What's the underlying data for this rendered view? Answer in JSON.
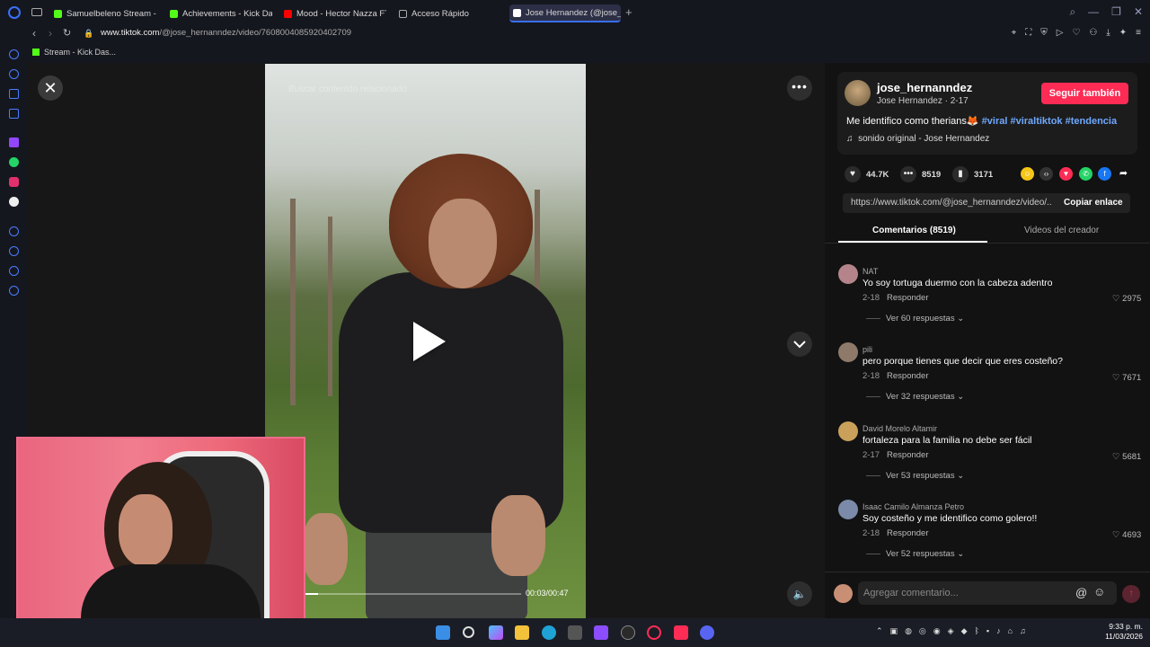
{
  "browser": {
    "tabs": [
      {
        "label": "Samuelbeleno Stream - W",
        "favicon": "kick-icon",
        "color": "#53fc18"
      },
      {
        "label": "Achievements - Kick Dash",
        "favicon": "kick-icon",
        "color": "#53fc18"
      },
      {
        "label": "Mood - Hector Nazza FT.",
        "favicon": "youtube-icon",
        "color": "#ff0000"
      },
      {
        "label": "Acceso Rápido",
        "favicon": "grid-icon",
        "color": "#aaaaaa"
      },
      {
        "label": "Jose Hernandez (@jose_h",
        "favicon": "tiktok-icon",
        "color": "#ffffff",
        "active": true
      }
    ],
    "url_prefix": "www.tiktok.com",
    "url_path": "/@jose_hernanndez/video/7608004085920402709",
    "bookmark": "Stream - Kick Das..."
  },
  "video": {
    "search_overlay": "Buscar contenido relacionado",
    "time": "00:03/00:47",
    "progress": 0.06
  },
  "creator": {
    "username": "jose_hernanndez",
    "display_name": "Jose Hernandez · 2-17",
    "follow_label": "Seguir también",
    "description": "Me identifico como therians🦊",
    "hashtags": [
      "#viral",
      "#viraltiktok",
      "#tendencia"
    ],
    "sound": "sonido original - Jose Hernandez"
  },
  "stats": {
    "likes": "44.7K",
    "comments": "8519",
    "saves": "3171"
  },
  "share": {
    "url": "https://www.tiktok.com/@jose_hernanndez/video/...",
    "copy_label": "Copiar enlace"
  },
  "tabs": {
    "comments": "Comentarios (8519)",
    "videos": "Videos del creador"
  },
  "comments": [
    {
      "user": "NAT",
      "text": "Yo soy tortuga duermo con la cabeza adentro",
      "date": "2-18",
      "reply": "Responder",
      "likes": "2975",
      "replies": "Ver 60 respuestas",
      "avatar_color": "#b5848a"
    },
    {
      "user": "pili",
      "text": "pero porque tienes que decir que eres costeño?",
      "date": "2-18",
      "reply": "Responder",
      "likes": "7671",
      "replies": "Ver 32 respuestas",
      "avatar_color": "#8f7a6a"
    },
    {
      "user": "David Morelo Altamir",
      "text": "fortaleza para la familia no debe ser fácil",
      "date": "2-17",
      "reply": "Responder",
      "likes": "5681",
      "replies": "Ver 53 respuestas",
      "avatar_color": "#c9a15a"
    },
    {
      "user": "Isaac Camilo Almanza Petro",
      "text": "Soy costeño y me identifico como golero!!",
      "date": "2-18",
      "reply": "Responder",
      "likes": "4693",
      "replies": "Ver 52 respuestas",
      "avatar_color": "#7a8aa8"
    }
  ],
  "comment_input": {
    "placeholder": "Agregar comentario..."
  },
  "taskbar": {
    "time": "9:33 p. m.",
    "date": "11/03/2026"
  }
}
